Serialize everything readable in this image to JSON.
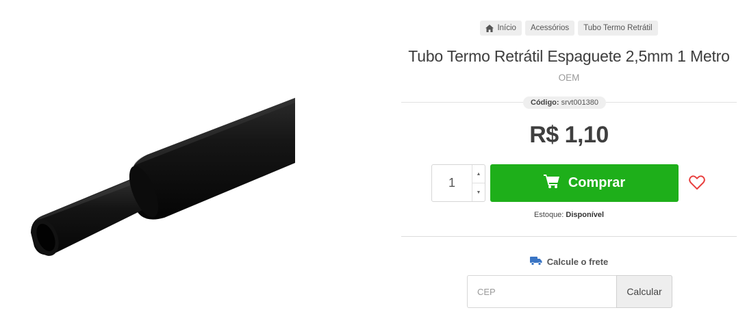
{
  "breadcrumb": {
    "items": [
      {
        "label": "Início",
        "icon": "home-icon"
      },
      {
        "label": "Acessórios"
      },
      {
        "label": "Tubo Termo Retrátil"
      }
    ]
  },
  "product": {
    "title": "Tubo Termo Retrátil Espaguete 2,5mm 1 Metro",
    "brand": "OEM",
    "code_label": "Código:",
    "code_value": "srvt001380",
    "price": "R$ 1,10",
    "quantity": "1",
    "buy_label": "Comprar",
    "stock_label": "Estoque:",
    "stock_value": "Disponível"
  },
  "shipping": {
    "label": "Calcule o frete",
    "placeholder": "CEP",
    "button_label": "Calcular"
  },
  "colors": {
    "buy_button": "#1eaf1a",
    "heart": "#e8403f",
    "truck": "#3a75c4"
  },
  "icons": {
    "home": "home-icon",
    "cart": "cart-icon",
    "heart": "heart-icon",
    "truck": "truck-icon",
    "qty_up": "chevron-up-icon",
    "qty_down": "chevron-down-icon"
  }
}
